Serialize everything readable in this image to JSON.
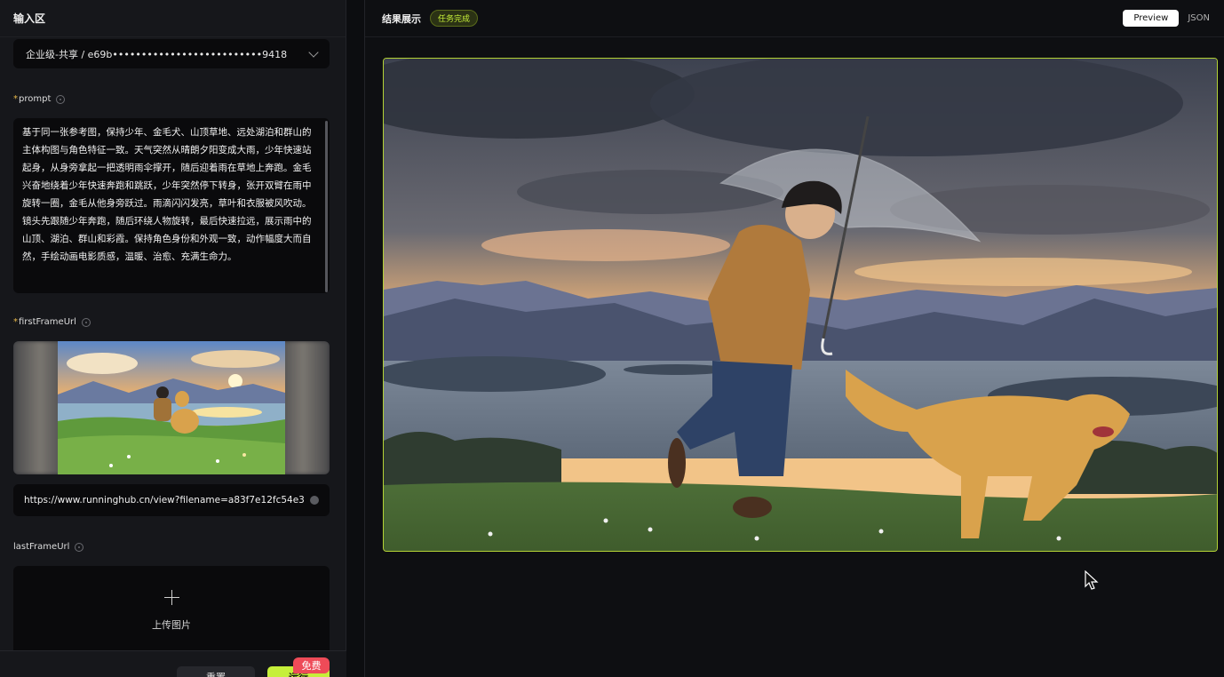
{
  "left_panel": {
    "title": "输入区",
    "model_select": {
      "value": "企业级-共享 / e69b••••••••••••••••••••••••••9418"
    },
    "prompt": {
      "required_mark": "*",
      "label": "prompt",
      "value": "基于同一张参考图，保持少年、金毛犬、山顶草地、远处湖泊和群山的主体构图与角色特征一致。天气突然从晴朗夕阳变成大雨，少年快速站起身，从身旁拿起一把透明雨伞撑开，随后迎着雨在草地上奔跑。金毛兴奋地绕着少年快速奔跑和跳跃，少年突然停下转身，张开双臂在雨中旋转一圈，金毛从他身旁跃过。雨滴闪闪发亮，草叶和衣服被风吹动。镜头先跟随少年奔跑，随后环绕人物旋转，最后快速拉远，展示雨中的山顶、湖泊、群山和彩霞。保持角色身份和外观一致，动作幅度大而自然，手绘动画电影质感，温暖、治愈、充满生命力。"
    },
    "first_frame": {
      "required_mark": "*",
      "label": "firstFrameUrl",
      "url": "https://www.runninghub.cn/view?filename=a83f7e12fc54e3"
    },
    "last_frame": {
      "label": "lastFrameUrl",
      "upload_text": "上传图片"
    },
    "buttons": {
      "reset": "重置",
      "run": "运行",
      "free_badge": "免费"
    }
  },
  "right_panel": {
    "title": "结果展示",
    "status": "任务完成",
    "tabs": [
      "Preview",
      "JSON"
    ],
    "active_tab": "Preview"
  },
  "colors": {
    "accent": "#c6ef3a",
    "badge_red": "#ee4b58"
  }
}
